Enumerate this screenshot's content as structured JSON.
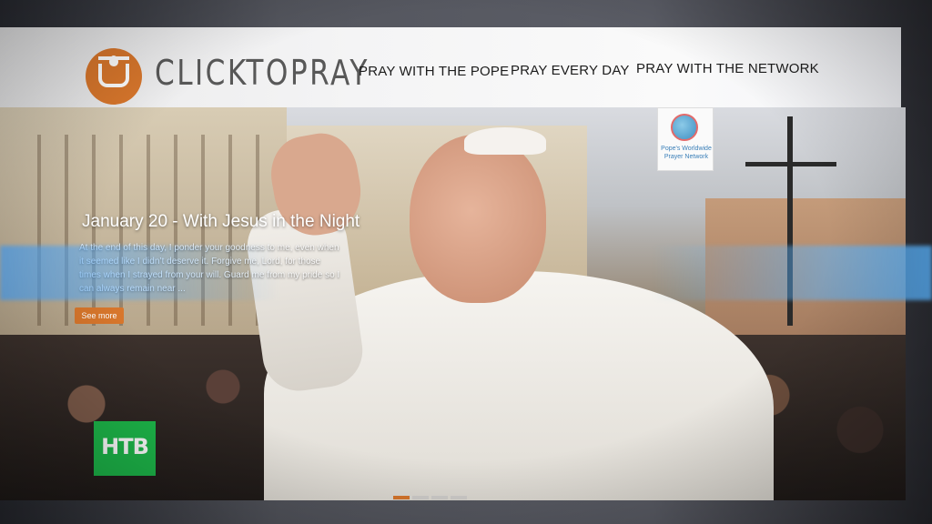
{
  "header": {
    "brand": "CLICKTOPRAY",
    "logo_icon": "candle-cup-icon",
    "nav": [
      {
        "label": "PRAY WITH THE POPE"
      },
      {
        "label": "PRAY EVERY DAY"
      },
      {
        "label": "PRAY WITH THE NETWORK"
      }
    ]
  },
  "hero": {
    "title": "January 20 - With Jesus in the Night",
    "description": "At the end of this day, I ponder your goodness to me, even when it seemed like I didn’t deserve it. Forgive me, Lord, for those times when I strayed from your will. Guard me from my pride so I can always remain near ...",
    "cta_label": "See more",
    "badge_text": "Pope's Worldwide Prayer Network",
    "slides_total": 4,
    "slide_active": 1
  },
  "overlay": {
    "channel_logo": "НТВ"
  },
  "colors": {
    "accent": "#d9772c",
    "channel_green": "#1db84a"
  }
}
